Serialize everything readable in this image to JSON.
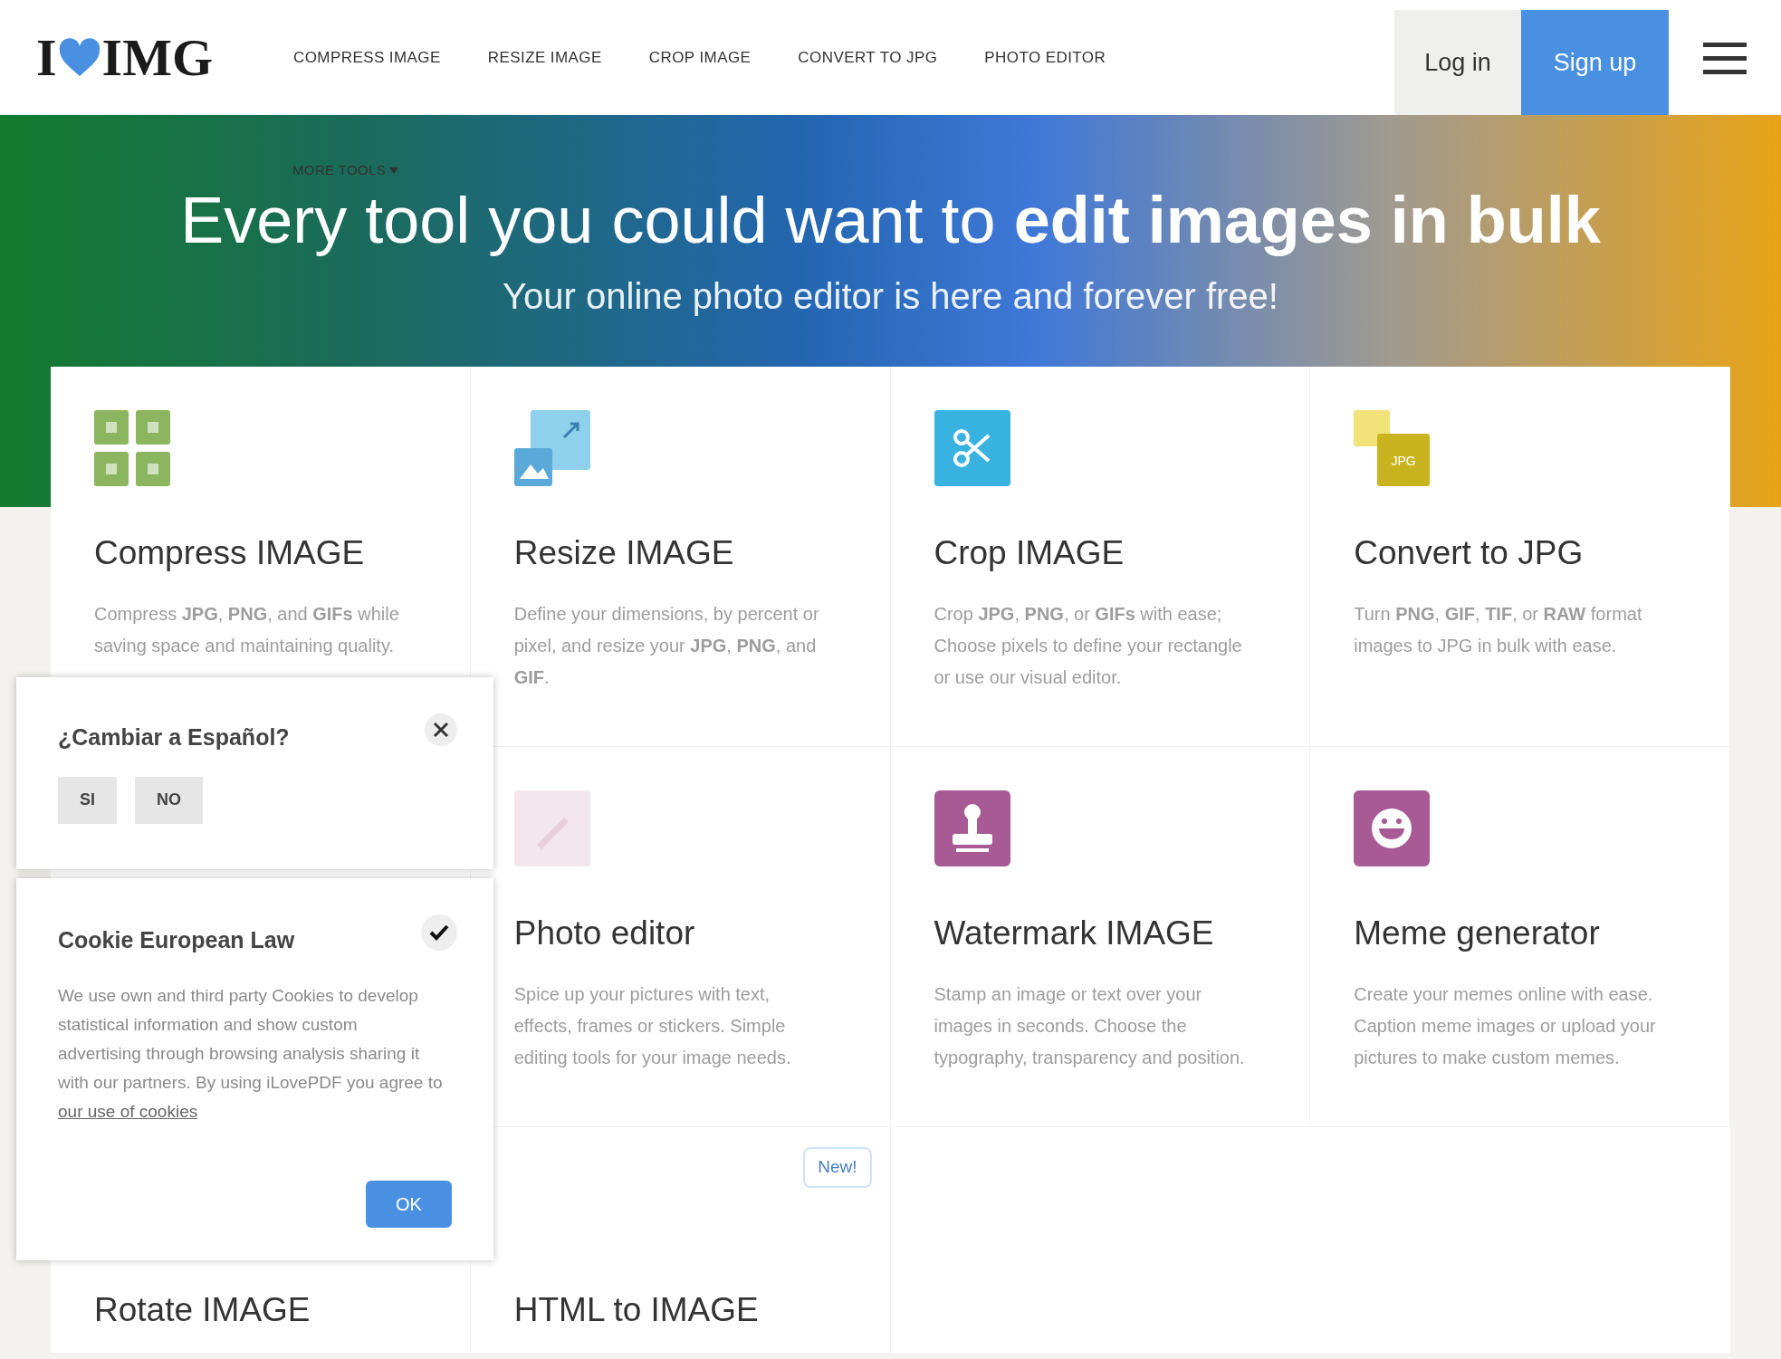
{
  "header": {
    "logo": {
      "left": "I",
      "right": "IMG"
    },
    "nav": [
      "COMPRESS IMAGE",
      "RESIZE IMAGE",
      "CROP IMAGE",
      "CONVERT TO JPG",
      "PHOTO EDITOR"
    ],
    "more_tools": "MORE TOOLS",
    "login": "Log in",
    "signup": "Sign up"
  },
  "hero": {
    "title": "Every tool you could want to **edit images in bulk**",
    "subtitle": "Your online photo editor is here and forever free!"
  },
  "tools": [
    {
      "title": "Compress IMAGE",
      "description": "Compress **JPG**, **PNG**, and **GIFs** while saving space and maintaining quality.",
      "kind": "grid",
      "color": "#8bb55e"
    },
    {
      "title": "Resize IMAGE",
      "description": "Define your dimensions, by percent or pixel, and resize your **JPG**, **PNG**, and **GIF**.",
      "kind": "resize",
      "color": "#8fd0ec"
    },
    {
      "title": "Crop IMAGE",
      "description": "Crop **JPG**, **PNG**, or **GIFs** with ease; Choose pixels to define your rectangle or use our visual editor.",
      "kind": "scissors",
      "color": "#38b2e0"
    },
    {
      "title": "Convert to JPG",
      "description": "Turn **PNG**, **GIF**, **TIF**, or **RAW** format images to JPG in bulk with ease.",
      "kind": "jpg",
      "icon_label": "JPG",
      "color": "#c9b41f"
    },
    {
      "kind": "hidden"
    },
    {
      "title": "Photo editor",
      "description": "Spice up your pictures with text, effects, frames or stickers. Simple editing tools for your image needs.",
      "kind": "pencil",
      "color": "#f3e6ec"
    },
    {
      "title": "Watermark IMAGE",
      "description": "Stamp an image or text over your images in seconds. Choose the typography, transparency and position.",
      "kind": "stamp",
      "color": "#a85a94"
    },
    {
      "title": "Meme generator",
      "description": "Create your memes online with ease. Caption meme images or upload your pictures to make custom memes.",
      "kind": "smiley",
      "color": "#a85a94"
    },
    {
      "title": "Rotate IMAGE"
    },
    {
      "title": "HTML to IMAGE",
      "badge": "New!"
    }
  ],
  "language_popup": {
    "question": "¿Cambiar a Español?",
    "buttons": [
      "SI",
      "NO"
    ]
  },
  "cookie_popup": {
    "title": "Cookie European Law",
    "text": "We use own and third party Cookies to develop statistical information and show custom advertising through browsing analysis sharing it with our partners. By using iLovePDF you agree to",
    "link": "our use of cookies",
    "ok": "OK"
  }
}
